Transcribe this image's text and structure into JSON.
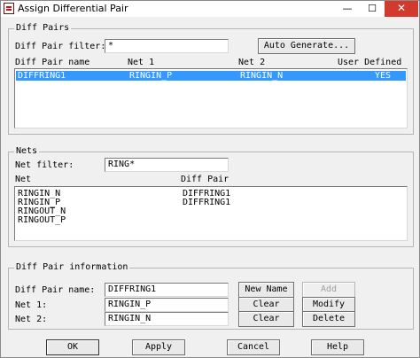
{
  "window": {
    "title": "Assign Differential Pair",
    "controls": {
      "minimize": "—",
      "maximize": "☐",
      "close": "✕"
    }
  },
  "diff_pairs": {
    "legend": "Diff Pairs",
    "filter_label": "Diff Pair filter:",
    "filter_value": "*",
    "auto_generate_label": "Auto Generate...",
    "columns": [
      "Diff Pair name",
      "Net 1",
      "Net 2",
      "User Defined"
    ],
    "rows": [
      {
        "name": "DIFFRING1",
        "net1": "RINGIN_P",
        "net2": "RINGIN_N",
        "user_defined": "YES"
      }
    ]
  },
  "nets": {
    "legend": "Nets",
    "filter_label": "Net filter:",
    "filter_value": "RING*",
    "columns": [
      "Net",
      "Diff Pair"
    ],
    "rows": [
      {
        "net": "RINGIN_N",
        "diff_pair": "DIFFRING1"
      },
      {
        "net": "RINGIN_P",
        "diff_pair": "DIFFRING1"
      },
      {
        "net": "RINGOUT_N",
        "diff_pair": ""
      },
      {
        "net": "RINGOUT_P",
        "diff_pair": ""
      }
    ]
  },
  "info": {
    "legend": "Diff Pair information",
    "name_label": "Diff Pair name:",
    "name_value": "DIFFRING1",
    "net1_label": "Net 1:",
    "net1_value": "RINGIN_P",
    "net2_label": "Net 2:",
    "net2_value": "RINGIN_N",
    "new_name_label": "New Name",
    "clear1_label": "Clear",
    "clear2_label": "Clear",
    "add_label": "Add",
    "modify_label": "Modify",
    "delete_label": "Delete"
  },
  "footer": {
    "ok_label": "OK",
    "apply_label": "Apply",
    "cancel_label": "Cancel",
    "help_label": "Help"
  }
}
